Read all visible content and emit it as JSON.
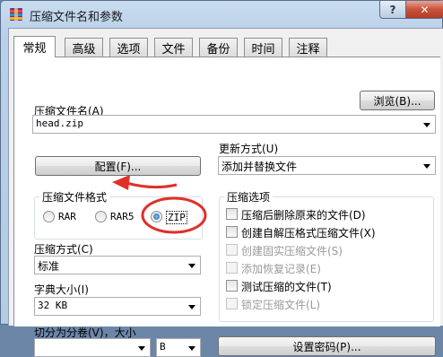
{
  "window": {
    "title": "压缩文件名和参数",
    "help_glyph": "?",
    "close_glyph": "✕"
  },
  "tabs": [
    {
      "label": "常规",
      "active": true
    },
    {
      "label": "高级"
    },
    {
      "label": "选项"
    },
    {
      "label": "文件"
    },
    {
      "label": "备份"
    },
    {
      "label": "时间"
    },
    {
      "label": "注释"
    }
  ],
  "archive_name": {
    "label": "压缩文件名(A)",
    "value": "head.zip",
    "browse_label": "浏览(B)..."
  },
  "update_mode": {
    "label": "更新方式(U)",
    "value": "添加并替换文件"
  },
  "profiles_button": "配置(F)...",
  "format": {
    "group_title": "压缩文件格式",
    "options": [
      "RAR",
      "RAR5",
      "ZIP"
    ],
    "selected": "ZIP"
  },
  "method": {
    "label": "压缩方式(C)",
    "value": "标准"
  },
  "dictionary": {
    "label": "字典大小(I)",
    "value": "32 KB"
  },
  "split": {
    "label": "切分为分卷(V)，大小",
    "unit": "B"
  },
  "archive_options": {
    "group_title": "压缩选项",
    "items": [
      {
        "label": "压缩后删除原来的文件(D)",
        "enabled": true
      },
      {
        "label": "创建自解压格式压缩文件(X)",
        "enabled": true
      },
      {
        "label": "创建固实压缩文件(S)",
        "enabled": false
      },
      {
        "label": "添加恢复记录(E)",
        "enabled": false
      },
      {
        "label": "测试压缩的文件(T)",
        "enabled": true
      },
      {
        "label": "锁定压缩文件(L)",
        "enabled": false
      }
    ]
  },
  "set_password_button": "设置密码(P)...",
  "annotation_color": "#e0302a",
  "icons": [
    "winrar-app-icon",
    "help-icon",
    "close-icon",
    "chevron-down-icon",
    "red-arrow-annotation",
    "red-circle-annotation"
  ]
}
